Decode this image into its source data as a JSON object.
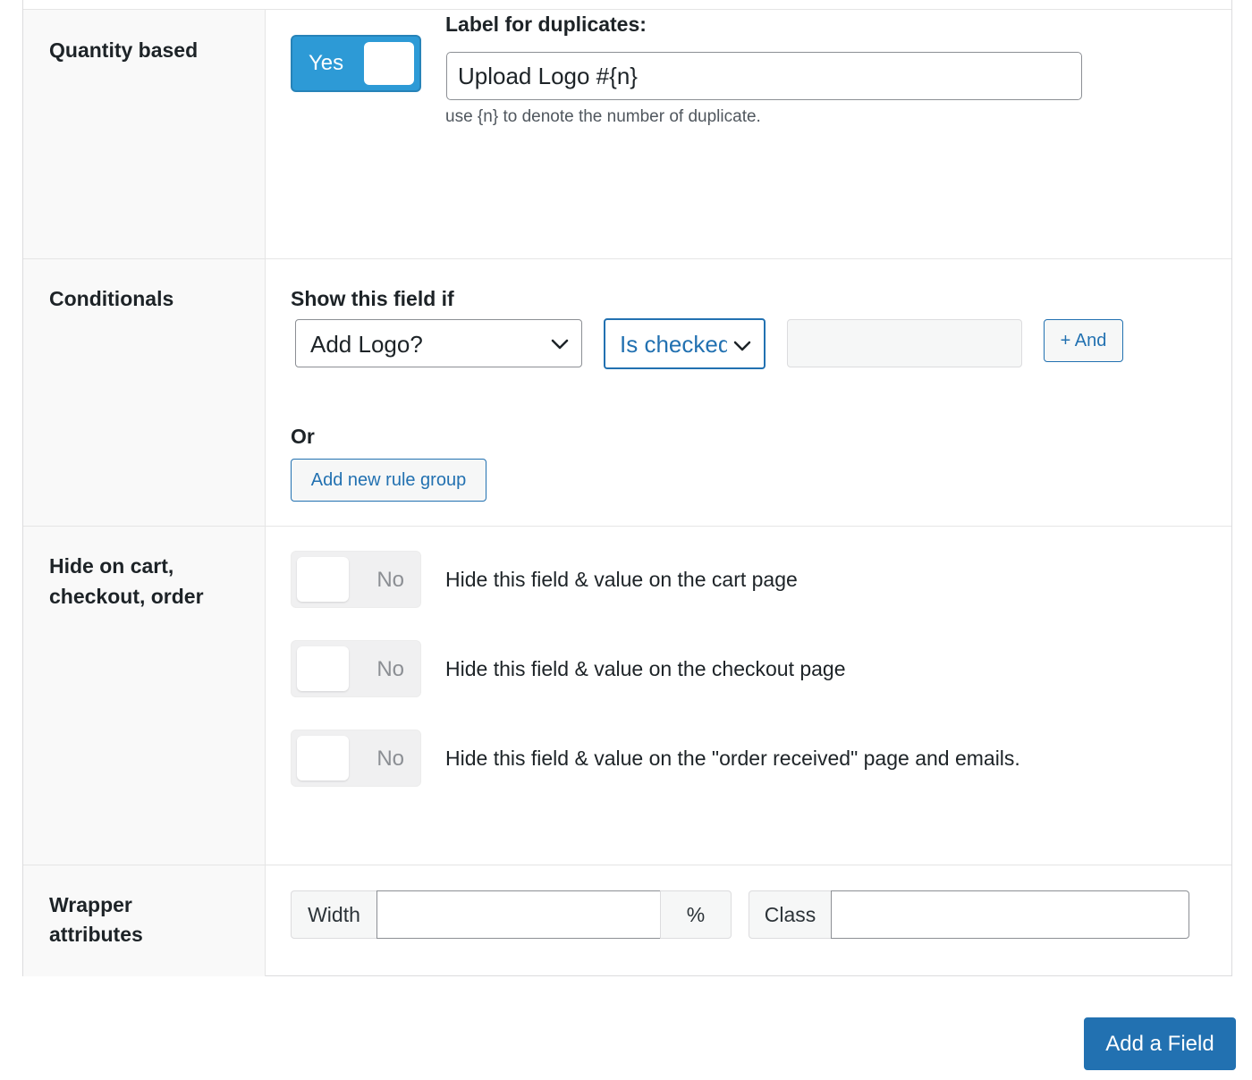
{
  "quantity_based": {
    "label": "Quantity based",
    "toggle_label": "Yes",
    "duplicates_title": "Label for duplicates:",
    "duplicates_value": "Upload Logo #{n}",
    "duplicates_hint": "use {n} to denote the number of duplicate."
  },
  "conditionals": {
    "label": "Conditionals",
    "show_if": "Show this field if",
    "field_select": "Add Logo?",
    "operator_select": "Is checked",
    "value_input": "",
    "and_button": "+ And",
    "or_label": "Or",
    "add_group_button": "Add new rule group"
  },
  "hide": {
    "label_line1": "Hide on cart,",
    "label_line2": "checkout, order",
    "items": [
      {
        "toggle": "No",
        "text": "Hide this field & value on the cart page"
      },
      {
        "toggle": "No",
        "text": "Hide this field & value on the checkout page"
      },
      {
        "toggle": "No",
        "text": "Hide this field & value on the \"order received\" page and emails."
      }
    ]
  },
  "wrapper": {
    "label_line1": "Wrapper",
    "label_line2": "attributes",
    "width_label": "Width",
    "width_value": "",
    "width_unit": "%",
    "class_label": "Class",
    "class_value": ""
  },
  "footer": {
    "add_field_button": "Add a Field"
  },
  "colors": {
    "toggle_on": "#2d9ad6",
    "primary": "#2271b1"
  }
}
